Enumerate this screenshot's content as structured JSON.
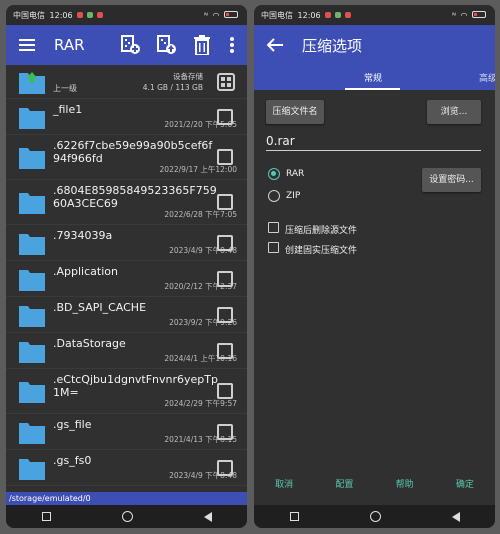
{
  "status": {
    "carrier": "中国电信",
    "time": "12:06",
    "battery_label": ""
  },
  "left": {
    "app_title": "RAR",
    "up_label": "上一级",
    "storage_label": "设备存储",
    "storage_size": "4.1 GB / 113 GB",
    "path": "/storage/emulated/0",
    "files": [
      {
        "name": "_file1",
        "date": "2021/2/20 下午5:05"
      },
      {
        "name": ".6226f7cbe59e99a90b5cef6f94f966fd",
        "date": "2022/9/17 上午12:00"
      },
      {
        "name": ".6804E85985849523365F75960A3CEC69",
        "date": "2022/6/28 下午7:05"
      },
      {
        "name": ".7934039a",
        "date": "2023/4/9 下午8:48"
      },
      {
        "name": ".Application",
        "date": "2020/2/12 下午2:37"
      },
      {
        "name": ".BD_SAPI_CACHE",
        "date": "2023/9/2 下午9:26"
      },
      {
        "name": ".DataStorage",
        "date": "2024/4/1 上午10:16"
      },
      {
        "name": ".eCtcQjbu1dgnvtFnvnr6yepTp1M=",
        "date": "2024/2/29 下午9:57"
      },
      {
        "name": ".gs_file",
        "date": "2021/4/13 下午8:15"
      },
      {
        "name": ".gs_fs0",
        "date": "2023/4/9 下午8:48"
      }
    ]
  },
  "right": {
    "title": "压缩选项",
    "tab_general": "常规",
    "tab_advanced": "高级",
    "archive_name_button": "压缩文件名",
    "browse_button": "浏览...",
    "filename": "0.rar",
    "format_rar": "RAR",
    "format_zip": "ZIP",
    "format_selected": "RAR",
    "set_password_button": "设置密码...",
    "delete_after": "压缩后删除源文件",
    "solid_archive": "创建固实压缩文件",
    "cancel": "取消",
    "profiles": "配置",
    "help": "帮助",
    "ok": "确定"
  },
  "colors": {
    "appbar": "#3d4fb4",
    "accent": "#5ac8b0",
    "folder": "#4aa3df"
  }
}
